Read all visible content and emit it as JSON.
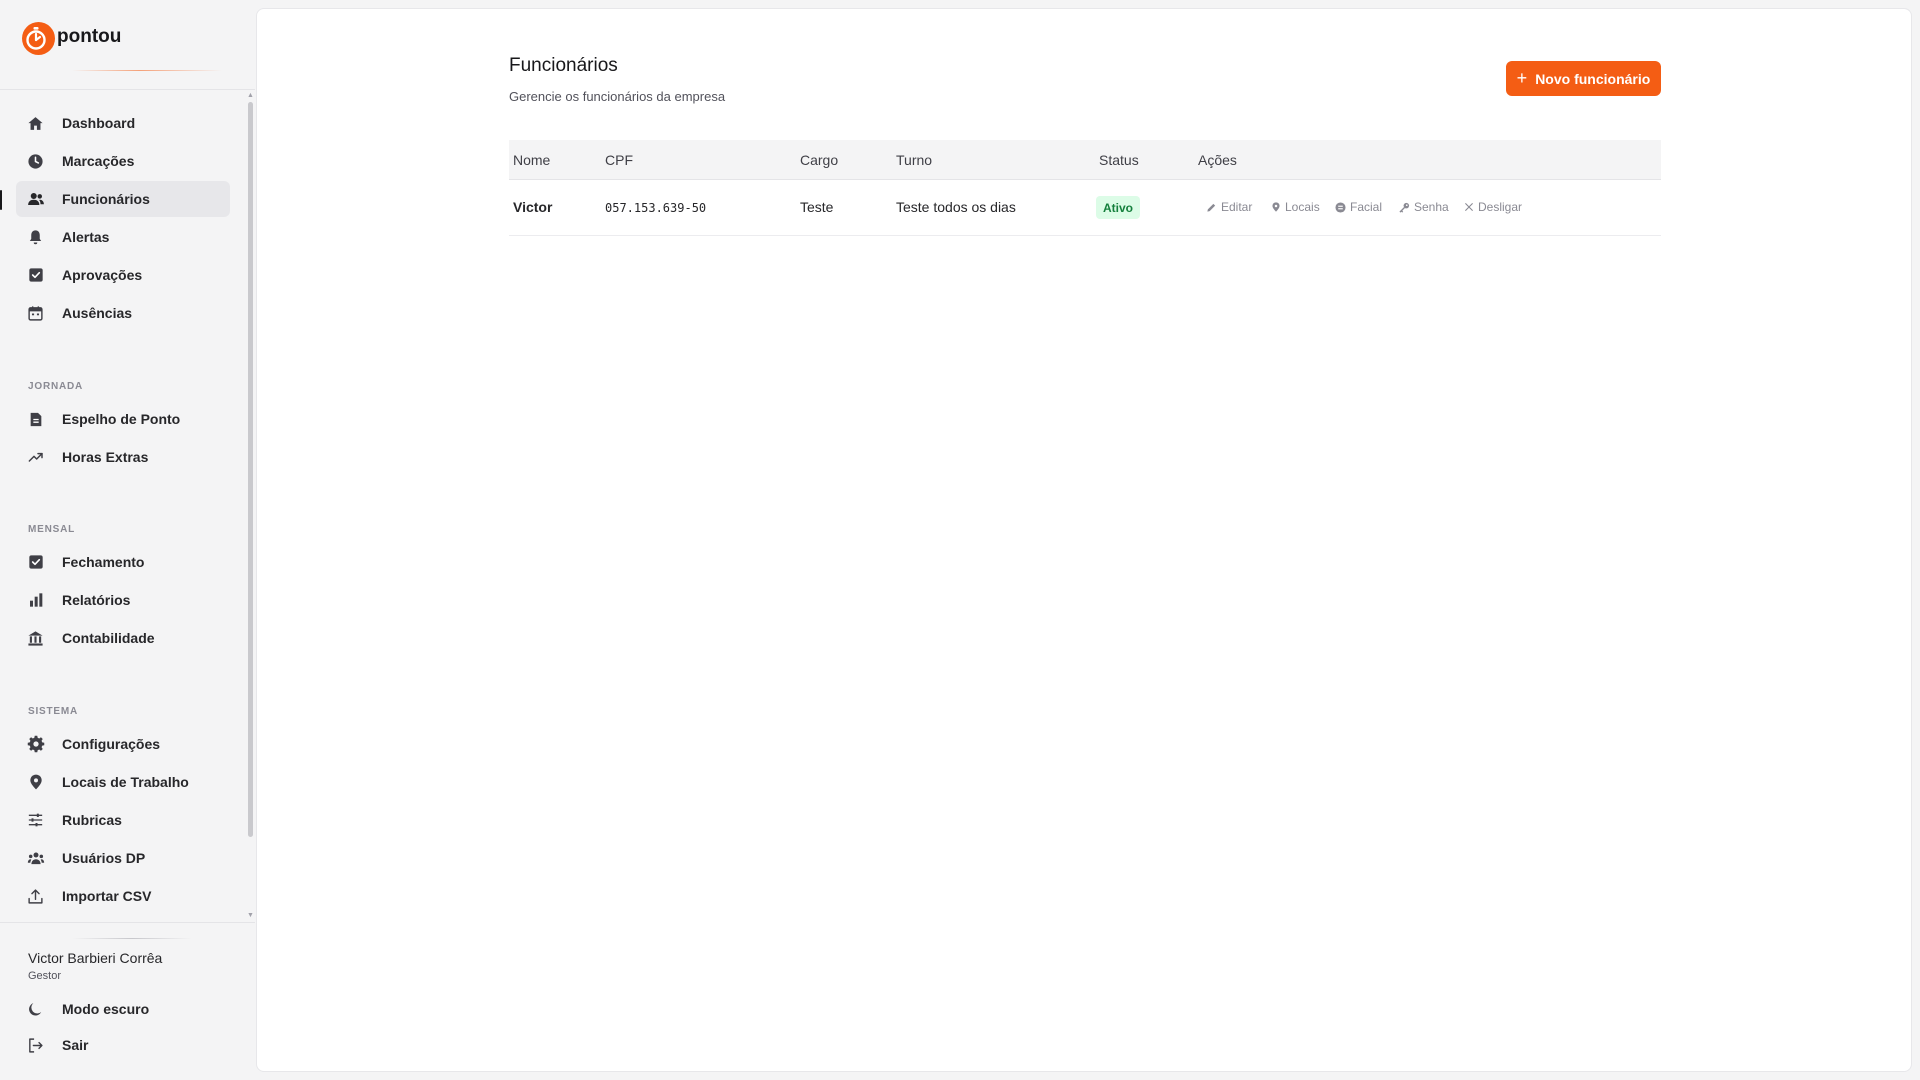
{
  "brand": {
    "name": "pontou",
    "accent": "#f45d14"
  },
  "sidebar": {
    "main_items": [
      {
        "label": "Dashboard",
        "icon": "home-icon"
      },
      {
        "label": "Marcações",
        "icon": "clock-icon"
      },
      {
        "label": "Funcionários",
        "icon": "users-icon",
        "active": true
      },
      {
        "label": "Alertas",
        "icon": "bell-icon"
      },
      {
        "label": "Aprovações",
        "icon": "check-square-icon"
      },
      {
        "label": "Ausências",
        "icon": "calendar-icon"
      }
    ],
    "sections": [
      {
        "title": "JORNADA",
        "items": [
          {
            "label": "Espelho de Ponto",
            "icon": "document-icon"
          },
          {
            "label": "Horas Extras",
            "icon": "trending-up-icon"
          }
        ]
      },
      {
        "title": "MENSAL",
        "items": [
          {
            "label": "Fechamento",
            "icon": "check-square-icon"
          },
          {
            "label": "Relatórios",
            "icon": "bar-chart-icon"
          },
          {
            "label": "Contabilidade",
            "icon": "bank-icon"
          }
        ]
      },
      {
        "title": "SISTEMA",
        "items": [
          {
            "label": "Configurações",
            "icon": "gear-icon"
          },
          {
            "label": "Locais de Trabalho",
            "icon": "map-pin-icon"
          },
          {
            "label": "Rubricas",
            "icon": "sliders-icon"
          },
          {
            "label": "Usuários DP",
            "icon": "users-icon"
          },
          {
            "label": "Importar CSV",
            "icon": "upload-icon"
          }
        ]
      }
    ],
    "user": {
      "name": "Victor Barbieri Corrêa",
      "role": "Gestor"
    },
    "dark_mode_label": "Modo escuro",
    "logout_label": "Sair"
  },
  "page": {
    "title": "Funcionários",
    "subtitle": "Gerencie os funcionários da empresa",
    "new_button_label": "Novo funcionário"
  },
  "table": {
    "columns": [
      "Nome",
      "CPF",
      "Cargo",
      "Turno",
      "Status",
      "Ações"
    ],
    "rows": [
      {
        "nome": "Victor",
        "cpf": "057.153.639-50",
        "cargo": "Teste",
        "turno": "Teste todos os dias",
        "status": "Ativo",
        "actions": [
          "Editar",
          "Locais",
          "Facial",
          "Senha",
          "Desligar"
        ]
      }
    ]
  }
}
